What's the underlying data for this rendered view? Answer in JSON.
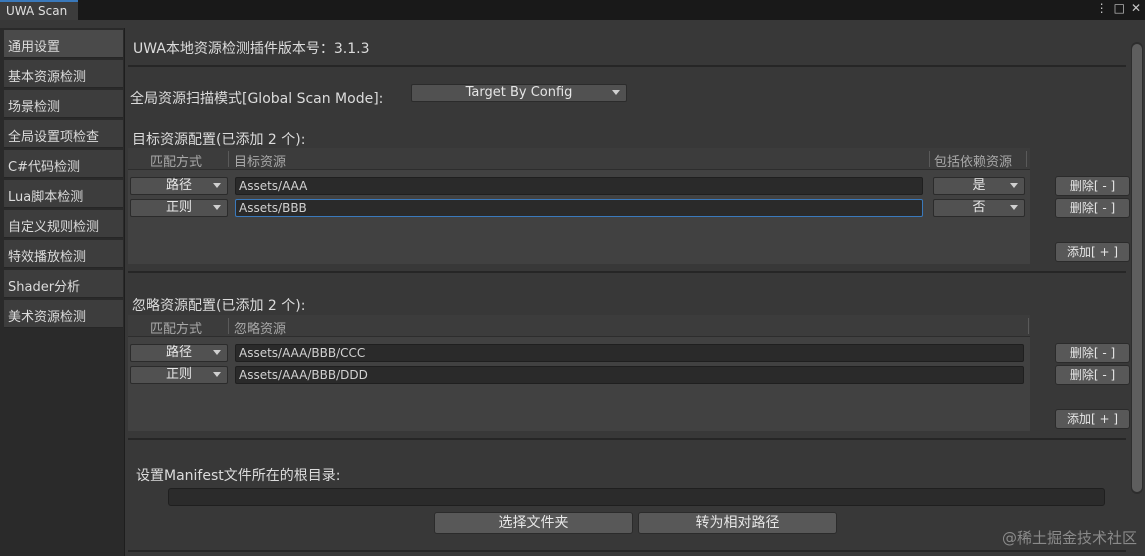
{
  "window": {
    "tab_title": "UWA Scan",
    "icons": [
      "kebab-menu-icon",
      "maximize-icon",
      "close-icon"
    ],
    "icon_glyphs": [
      "⋮",
      "□",
      "✕"
    ]
  },
  "sidebar": {
    "items": [
      {
        "label": "通用设置",
        "active": true
      },
      {
        "label": "基本资源检测"
      },
      {
        "label": "场景检测"
      },
      {
        "label": "全局设置项检查"
      },
      {
        "label": "C#代码检测"
      },
      {
        "label": "Lua脚本检测"
      },
      {
        "label": "自定义规则检测"
      },
      {
        "label": "特效播放检测"
      },
      {
        "label": "Shader分析"
      },
      {
        "label": "美术资源检测"
      }
    ]
  },
  "main": {
    "version_label": "UWA本地资源检测插件版本号：3.1.3",
    "scan_mode_label": "全局资源扫描模式[Global Scan Mode]:",
    "scan_mode_value": "Target By Config",
    "target": {
      "title": "目标资源配置(已添加 2 个):",
      "headers": [
        "匹配方式",
        "目标资源",
        "包括依赖资源"
      ],
      "rows": [
        {
          "match": "路径",
          "path": "Assets/AAA",
          "include_deps": "是",
          "delete": "删除[ - ]"
        },
        {
          "match": "正则",
          "path": "Assets/BBB",
          "include_deps": "否",
          "delete": "删除[ - ]"
        }
      ],
      "add": "添加[ + ]"
    },
    "ignore": {
      "title": "忽略资源配置(已添加 2 个):",
      "headers": [
        "匹配方式",
        "忽略资源"
      ],
      "rows": [
        {
          "match": "路径",
          "path": "Assets/AAA/BBB/CCC",
          "delete": "删除[ - ]"
        },
        {
          "match": "正则",
          "path": "Assets/AAA/BBB/DDD",
          "delete": "删除[ - ]"
        }
      ],
      "add": "添加[ + ]"
    },
    "manifest_label": "设置Manifest文件所在的根目录:",
    "manifest_value": "",
    "choose_folder": "选择文件夹",
    "to_relative": "转为相对路径"
  },
  "watermark": "@稀土掘金技术社区",
  "colors": {
    "accent": "#3a79bb",
    "panel": "#383838",
    "field": "#2a2a2a"
  }
}
